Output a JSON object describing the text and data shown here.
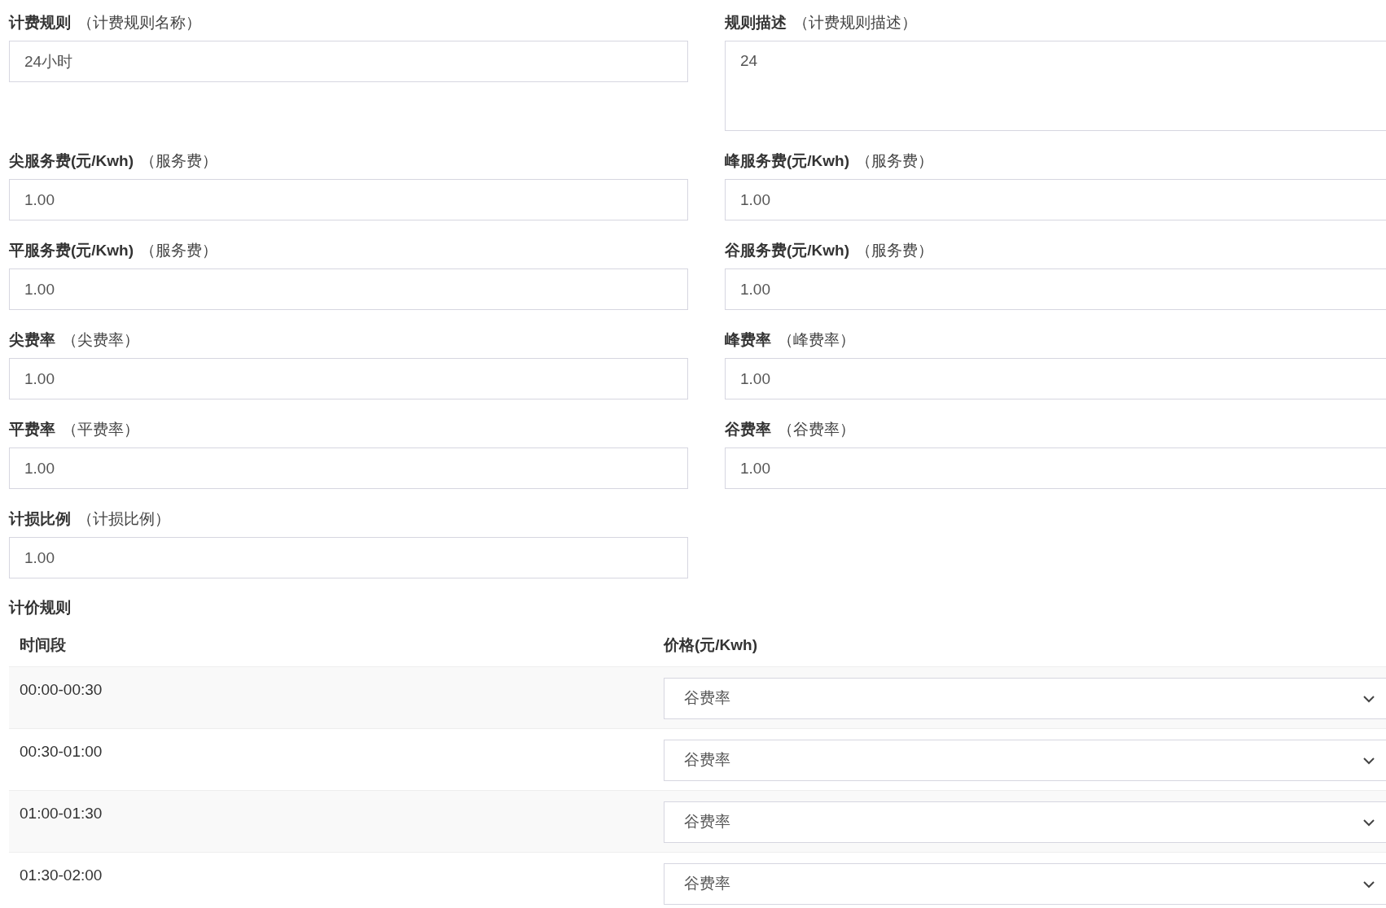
{
  "fields": [
    {
      "label": "计费规则",
      "hint": "（计费规则名称）",
      "value": "24小时",
      "kind": "input"
    },
    {
      "label": "规则描述",
      "hint": "（计费规则描述）",
      "value": "24",
      "kind": "textarea"
    },
    {
      "label": "尖服务费(元/Kwh)",
      "hint": "（服务费）",
      "value": "1.00",
      "kind": "input"
    },
    {
      "label": "峰服务费(元/Kwh)",
      "hint": "（服务费）",
      "value": "1.00",
      "kind": "input"
    },
    {
      "label": "平服务费(元/Kwh)",
      "hint": "（服务费）",
      "value": "1.00",
      "kind": "input"
    },
    {
      "label": "谷服务费(元/Kwh)",
      "hint": "（服务费）",
      "value": "1.00",
      "kind": "input"
    },
    {
      "label": "尖费率",
      "hint": "（尖费率）",
      "value": "1.00",
      "kind": "input"
    },
    {
      "label": "峰费率",
      "hint": "（峰费率）",
      "value": "1.00",
      "kind": "input"
    },
    {
      "label": "平费率",
      "hint": "（平费率）",
      "value": "1.00",
      "kind": "input"
    },
    {
      "label": "谷费率",
      "hint": "（谷费率）",
      "value": "1.00",
      "kind": "input"
    },
    {
      "label": "计损比例",
      "hint": "（计损比例）",
      "value": "1.00",
      "kind": "input"
    }
  ],
  "pricing": {
    "title": "计价规则",
    "columns": [
      "时间段",
      "价格(元/Kwh)"
    ],
    "rows": [
      {
        "time": "00:00-00:30",
        "price": "谷费率"
      },
      {
        "time": "00:30-01:00",
        "price": "谷费率"
      },
      {
        "time": "01:00-01:30",
        "price": "谷费率"
      },
      {
        "time": "01:30-02:00",
        "price": "谷费率"
      }
    ]
  }
}
